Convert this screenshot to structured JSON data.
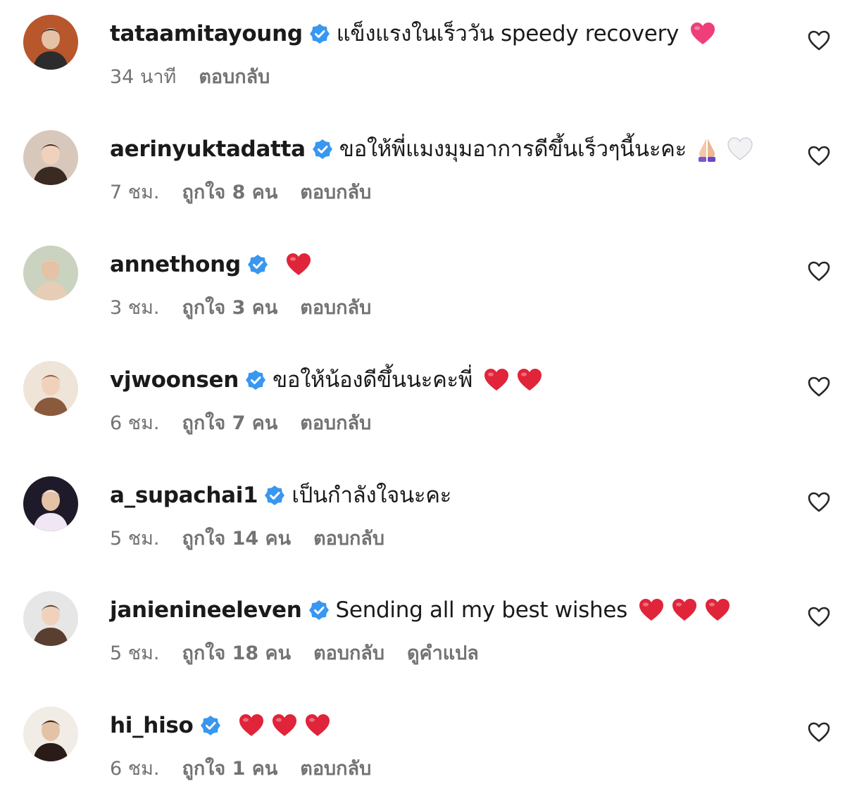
{
  "comments": [
    {
      "username": "tataamitayoung",
      "text": "แข็งแรงในเร็ววัน speedy recovery",
      "time": "34 นาที",
      "likes": "",
      "reply": "ตอบกลับ",
      "translate": "",
      "emojis": [
        "pink-heart-emoji"
      ],
      "avatar_colors": [
        "#b8572c",
        "#2c2c2c"
      ]
    },
    {
      "username": "aerinyuktadatta",
      "text": "ขอให้พี่แมงมุมอาการดีขึ้นเร็วๆนี้นะคะ",
      "time": "7 ชม.",
      "likes": "ถูกใจ 8 คน",
      "reply": "ตอบกลับ",
      "translate": "",
      "emojis": [
        "folded-hands-emoji",
        "white-heart-emoji"
      ],
      "avatar_colors": [
        "#d8c8bc",
        "#3a2a22"
      ]
    },
    {
      "username": "annethong",
      "text": "",
      "time": "3 ชม.",
      "likes": "ถูกใจ 3 คน",
      "reply": "ตอบกลับ",
      "translate": "",
      "emojis": [
        "red-heart-emoji"
      ],
      "avatar_colors": [
        "#c9d3c0",
        "#e8cdb6"
      ]
    },
    {
      "username": "vjwoonsen",
      "text": "ขอให้น้องดีขึ้นนะคะพี่",
      "time": "6 ชม.",
      "likes": "ถูกใจ 7 คน",
      "reply": "ตอบกลับ",
      "translate": "",
      "emojis": [
        "red-heart-emoji",
        "red-heart-emoji"
      ],
      "avatar_colors": [
        "#efe4d8",
        "#8a5a3c"
      ]
    },
    {
      "username": "a_supachai1",
      "text": "เป็นกำลังใจนะคะ",
      "time": "5 ชม.",
      "likes": "ถูกใจ 14 คน",
      "reply": "ตอบกลับ",
      "translate": "",
      "emojis": [],
      "avatar_colors": [
        "#1e1a2a",
        "#f0e6f4"
      ]
    },
    {
      "username": "janienineeleven",
      "text": "Sending all my best wishes",
      "time": "5 ชม.",
      "likes": "ถูกใจ 18 คน",
      "reply": "ตอบกลับ",
      "translate": "ดูคำแปล",
      "emojis": [
        "red-heart-emoji",
        "red-heart-emoji",
        "red-heart-emoji"
      ],
      "avatar_colors": [
        "#e6e6e6",
        "#5a3e30"
      ]
    },
    {
      "username": "hi_hiso",
      "text": "",
      "time": "6 ชม.",
      "likes": "ถูกใจ 1 คน",
      "reply": "ตอบกลับ",
      "translate": "",
      "emojis": [
        "red-heart-emoji",
        "red-heart-emoji",
        "red-heart-emoji"
      ],
      "avatar_colors": [
        "#f2ece6",
        "#2a1a18"
      ]
    }
  ],
  "icons": {
    "verified": "verified-badge-icon",
    "like": "heart-outline-icon"
  },
  "colors": {
    "verified_blue": "#3897f0",
    "heart_red": "#e0243a",
    "heart_pink": "#ee3f7b",
    "meta_gray": "#737373"
  }
}
